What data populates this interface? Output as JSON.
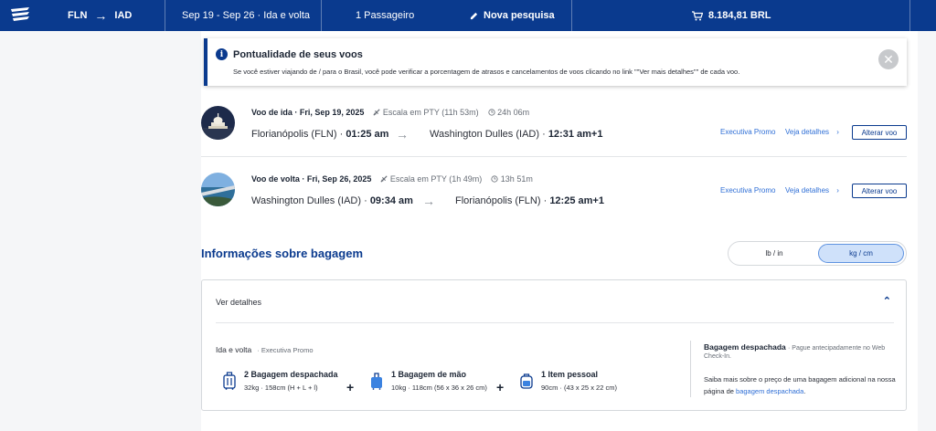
{
  "header": {
    "origin": "FLN",
    "destination": "IAD",
    "route_arrow": "→",
    "dates": "Sep 19 - Sep 26 · Ida e volta",
    "passengers": "1 Passageiro",
    "new_search": "Nova pesquisa",
    "total": "8.184,81 BRL"
  },
  "notice": {
    "title": "Pontualidade de seus voos",
    "text": "Se você estiver viajando de / para o Brasil, você pode verificar a porcentagem de atrasos e cancelamentos de voos clicando no link \"\"Ver mais detalhes\"\" de cada voo.",
    "info_glyph": "i",
    "close_glyph": "✕"
  },
  "flights": [
    {
      "label": "Voo de ida · Fri, Sep 19, 2025",
      "stop": "Escala em PTY (11h 53m)",
      "duration": "24h 06m",
      "from_city": "Florianópolis (FLN)",
      "from_time": "01:25 am",
      "to_city": "Washington Dulles (IAD)",
      "to_time": "12:31 am+1",
      "fare": "Executiva Promo",
      "details": "Veja detalhes",
      "change": "Alterar voo"
    },
    {
      "label": "Voo de volta · Fri, Sep 26, 2025",
      "stop": "Escala em PTY (1h 49m)",
      "duration": "13h 51m",
      "from_city": "Washington Dulles (IAD)",
      "from_time": "09:34 am",
      "to_city": "Florianópolis (FLN)",
      "to_time": "12:25 am+1",
      "fare": "Executiva Promo",
      "details": "Veja detalhes",
      "change": "Alterar voo"
    }
  ],
  "baggage": {
    "title": "Informações sobre bagagem",
    "units": [
      "lb / in",
      "kg / cm"
    ],
    "selected_unit": "kg / cm",
    "details_label": "Ver detalhes",
    "trip": "Ida e volta",
    "cabin": "· Executiva Promo",
    "items": [
      {
        "name": "2 Bagagem despachada",
        "dims": "32kg · 158cm (H + L + l)"
      },
      {
        "name": "1 Bagagem de mão",
        "dims": "10kg · 118cm (56 x 36 x 26 cm)"
      },
      {
        "name": "1 Item pessoal",
        "dims": "90cm · (43 x 25 x 22 cm)"
      }
    ],
    "plus": "+",
    "checked_title": "Bagagem despachada",
    "checked_prepay": "· Pague antecipadamente no Web Check-In.",
    "checked_note_pre": "Saiba mais sobre o preço de uma bagagem adicional na nossa página de ",
    "checked_note_link": "bagagem despachada",
    "checked_note_post": "."
  },
  "colors": {
    "brand": "#0a3a8e",
    "link": "#2f6fd6"
  }
}
